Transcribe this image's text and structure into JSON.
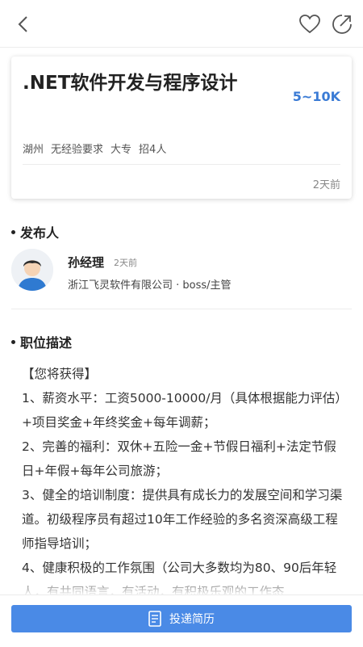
{
  "header": {
    "back_icon": "chevron-left-icon",
    "favorite_icon": "heart-icon",
    "share_icon": "share-icon"
  },
  "job": {
    "title": ".NET软件开发与程序设计",
    "salary": "5~10K",
    "tags": [
      "湖州",
      "无经验要求",
      "大专",
      "招4人"
    ],
    "posted": "2天前"
  },
  "publisher": {
    "section_title": "发布人",
    "name": "孙经理",
    "time": "2天前",
    "company_role": "浙江飞灵软件有限公司 · boss/主管"
  },
  "description": {
    "section_title": "职位描述",
    "lines": [
      "【您将获得】",
      "1、薪资水平：工资5000-10000/月（具体根据能力评估）+项目奖金+年终奖金+每年调薪；",
      "2、完善的福利：双休+五险一金+节假日福利+法定节假日+年假+每年公司旅游；",
      "3、健全的培训制度：提供具有成长力的发展空间和学习渠道。初级程序员有超过10年工作经验的多名资深高级工程师指导培训；",
      "4、健康积极的工作氛围（公司大多数均为80、90后年轻人，有共同语言，有活动，有积极乐观的工作态"
    ]
  },
  "footer": {
    "apply_label": "投递简历",
    "apply_icon": "resume-icon",
    "accent_color": "#4a8ae6"
  }
}
